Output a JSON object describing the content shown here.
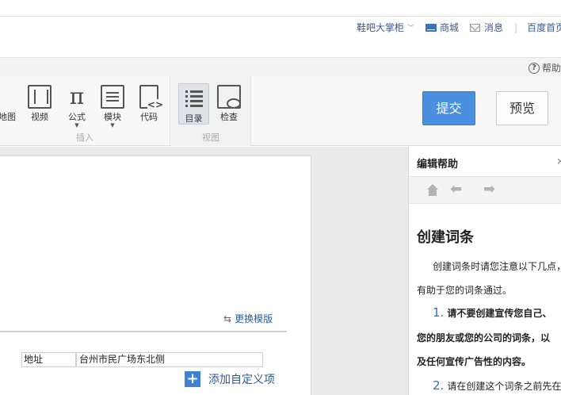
{
  "topnav": {
    "user": "鞋吧大掌柜",
    "mall": "商城",
    "messages": "消息",
    "baidu_home": "百度首页"
  },
  "helpstrip": {
    "help": "帮助"
  },
  "toolbar": {
    "insert_group_label": "插入",
    "view_group_label": "视图",
    "map": "地图",
    "video": "视频",
    "formula": "公式",
    "formula_icon": "π",
    "module": "模块",
    "code": "代码",
    "toc": "目录",
    "check": "检查",
    "submit": "提交",
    "preview": "预览"
  },
  "editor": {
    "change_template": "更换模版",
    "address_label": "地址",
    "address_value": "台州市民广场东北侧",
    "add_custom": "添加自定义项"
  },
  "help_panel": {
    "title": "编辑帮助",
    "heading": "创建词条",
    "intro_line1": "创建词条时请您注意以下几点，",
    "intro_line2": "有助于您的词条通过。",
    "item1_num": "1.",
    "item1_line1": "请不要创建宣传您自己、",
    "item1_line2": "您的朋友或您的公司的词条，以",
    "item1_line3": "及任何宣传广告性的内容。",
    "item2_num": "2.",
    "item2_line1": "请在创建这个词条之前先在"
  },
  "icons": {
    "mall": "store-icon",
    "messages": "mail-icon",
    "help": "question-icon",
    "home": "home-icon",
    "prev": "arrow-left-icon",
    "next": "arrow-right-icon",
    "close": "chevron-right-icon"
  },
  "colors": {
    "accent": "#4a8fe0",
    "link": "#2d5c9b"
  }
}
